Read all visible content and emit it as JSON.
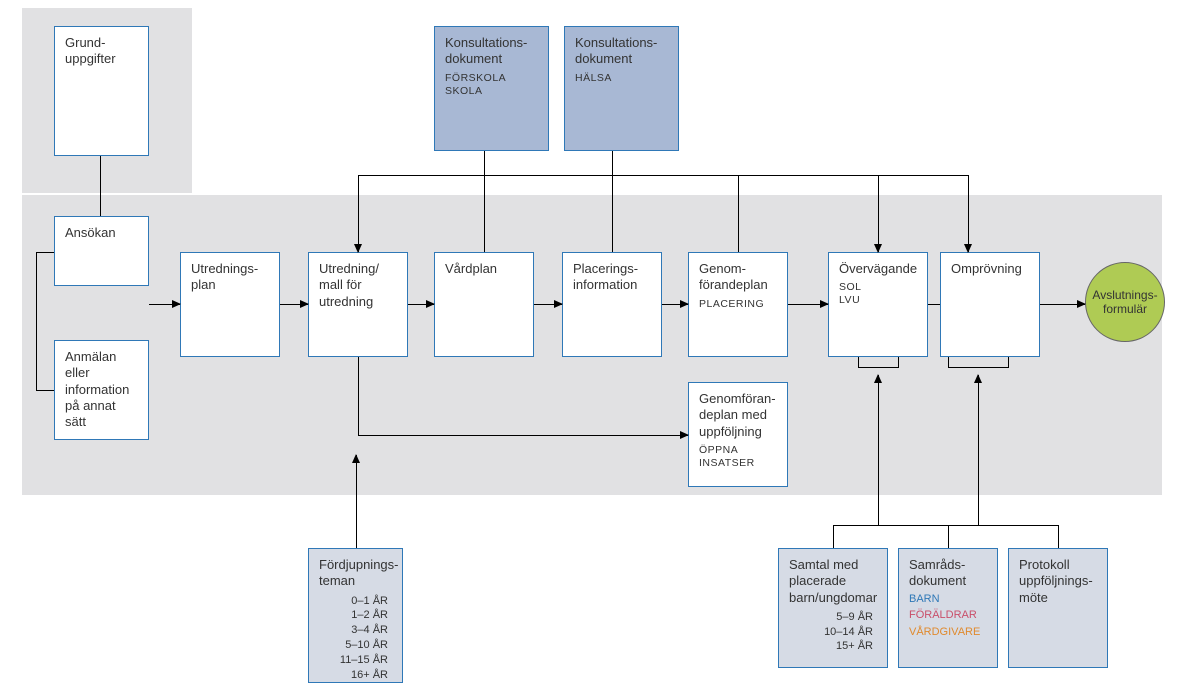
{
  "boxes": {
    "grund": "Grund-\nuppgifter",
    "ansokan": "Ansökan",
    "anmalan": "Anmälan eller information på annat sätt",
    "utredplan": "Utrednings-\nplan",
    "utredmall": "Utredning/ mall för utredning",
    "vardplan": "Vårdplan",
    "placinfo": "Placerings-\ninformation",
    "genomplan": {
      "title": "Genom-\nförandeplan",
      "sub": "PLACERING"
    },
    "overvag": {
      "title": "Övervägande",
      "sub": "SOL\nLVU"
    },
    "omprov": "Omprövning",
    "genomopp": {
      "title": "Genomföran-\ndeplan med uppföljning",
      "sub": "ÖPPNA\nINSATSER"
    },
    "kons1": {
      "title": "Konsultations-\ndokument",
      "sub": "FÖRSKOLA\nSKOLA"
    },
    "kons2": {
      "title": "Konsultations-\ndokument",
      "sub": "HÄLSA"
    },
    "fordjup": {
      "title": "Fördjupnings-\nteman",
      "items": "0–1 ÅR\n1–2 ÅR\n3–4 ÅR\n5–10 ÅR\n11–15 ÅR\n16+ ÅR"
    },
    "samtal": {
      "title": "Samtal med placerade barn/ungdomar",
      "items": "5–9 ÅR\n10–14 ÅR\n15+ ÅR"
    },
    "samrad": {
      "title": "Samråds-\ndokument",
      "barn": "BARN",
      "for": "FÖRÄLDRAR",
      "vard": "VÅRDGIVARE"
    },
    "protokoll": "Protokoll uppföljnings-\nmöte"
  },
  "circle": "Avslutnings-\nformulär"
}
